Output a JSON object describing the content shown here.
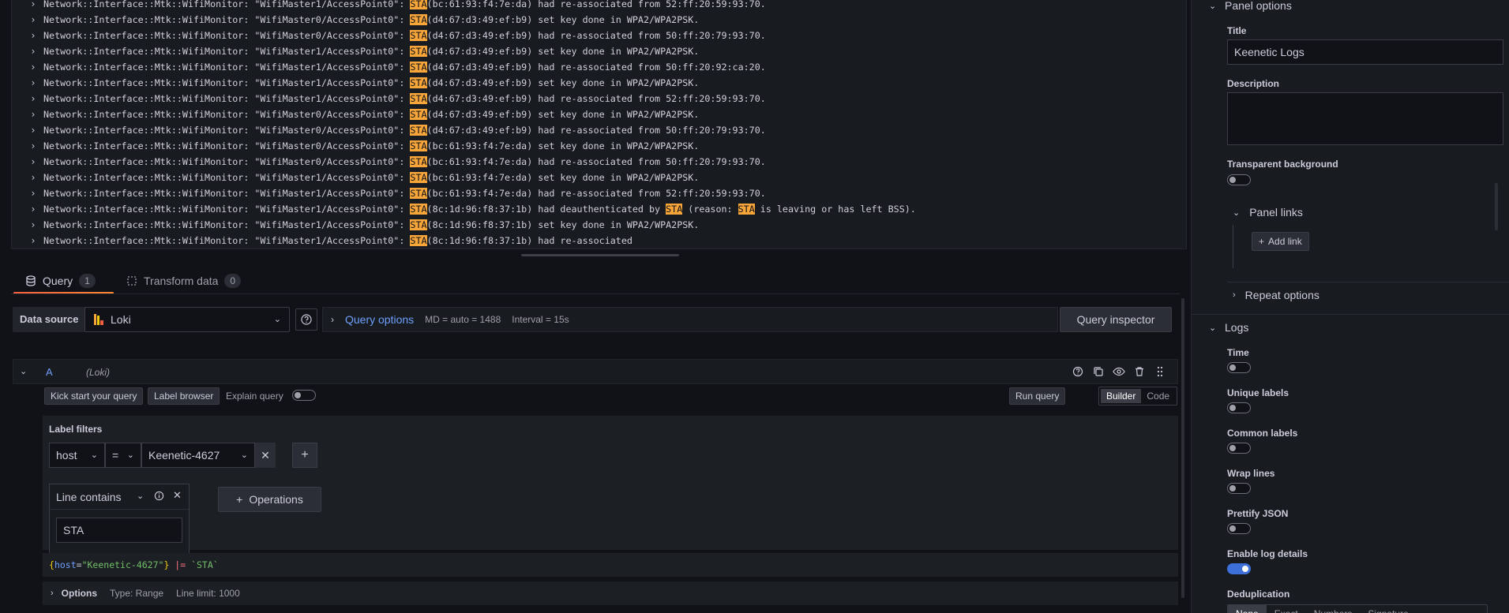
{
  "logs": {
    "lines": [
      {
        "pre": "Network::Interface::Mtk::WifiMonitor: \"WifiMaster1/AccessPoint0\": ",
        "hl": "STA",
        "post": "(bc:61:93:f4:7e:da) had re-associated from 52:ff:20:59:93:70."
      },
      {
        "pre": "Network::Interface::Mtk::WifiMonitor: \"WifiMaster0/AccessPoint0\": ",
        "hl": "STA",
        "post": "(d4:67:d3:49:ef:b9) set key done in WPA2/WPA2PSK."
      },
      {
        "pre": "Network::Interface::Mtk::WifiMonitor: \"WifiMaster0/AccessPoint0\": ",
        "hl": "STA",
        "post": "(d4:67:d3:49:ef:b9) had re-associated from 50:ff:20:79:93:70."
      },
      {
        "pre": "Network::Interface::Mtk::WifiMonitor: \"WifiMaster1/AccessPoint0\": ",
        "hl": "STA",
        "post": "(d4:67:d3:49:ef:b9) set key done in WPA2/WPA2PSK."
      },
      {
        "pre": "Network::Interface::Mtk::WifiMonitor: \"WifiMaster1/AccessPoint0\": ",
        "hl": "STA",
        "post": "(d4:67:d3:49:ef:b9) had re-associated from 50:ff:20:92:ca:20."
      },
      {
        "pre": "Network::Interface::Mtk::WifiMonitor: \"WifiMaster1/AccessPoint0\": ",
        "hl": "STA",
        "post": "(d4:67:d3:49:ef:b9) set key done in WPA2/WPA2PSK."
      },
      {
        "pre": "Network::Interface::Mtk::WifiMonitor: \"WifiMaster1/AccessPoint0\": ",
        "hl": "STA",
        "post": "(d4:67:d3:49:ef:b9) had re-associated from 52:ff:20:59:93:70."
      },
      {
        "pre": "Network::Interface::Mtk::WifiMonitor: \"WifiMaster0/AccessPoint0\": ",
        "hl": "STA",
        "post": "(d4:67:d3:49:ef:b9) set key done in WPA2/WPA2PSK."
      },
      {
        "pre": "Network::Interface::Mtk::WifiMonitor: \"WifiMaster0/AccessPoint0\": ",
        "hl": "STA",
        "post": "(d4:67:d3:49:ef:b9) had re-associated from 50:ff:20:79:93:70."
      },
      {
        "pre": "Network::Interface::Mtk::WifiMonitor: \"WifiMaster0/AccessPoint0\": ",
        "hl": "STA",
        "post": "(bc:61:93:f4:7e:da) set key done in WPA2/WPA2PSK."
      },
      {
        "pre": "Network::Interface::Mtk::WifiMonitor: \"WifiMaster0/AccessPoint0\": ",
        "hl": "STA",
        "post": "(bc:61:93:f4:7e:da) had re-associated from 50:ff:20:79:93:70."
      },
      {
        "pre": "Network::Interface::Mtk::WifiMonitor: \"WifiMaster1/AccessPoint0\": ",
        "hl": "STA",
        "post": "(bc:61:93:f4:7e:da) set key done in WPA2/WPA2PSK."
      },
      {
        "pre": "Network::Interface::Mtk::WifiMonitor: \"WifiMaster1/AccessPoint0\": ",
        "hl": "STA",
        "post": "(bc:61:93:f4:7e:da) had re-associated from 52:ff:20:59:93:70."
      },
      {
        "pre": "Network::Interface::Mtk::WifiMonitor: \"WifiMaster1/AccessPoint0\": ",
        "hl": "STA",
        "post": "(8c:1d:96:f8:37:1b) had deauthenticated by ",
        "hl2": "STA",
        "post2": " (reason: ",
        "hl3": "STA",
        "post3": " is leaving or has left BSS)."
      },
      {
        "pre": "Network::Interface::Mtk::WifiMonitor: \"WifiMaster1/AccessPoint0\": ",
        "hl": "STA",
        "post": "(8c:1d:96:f8:37:1b) set key done in WPA2/WPA2PSK."
      },
      {
        "pre": "Network::Interface::Mtk::WifiMonitor: \"WifiMaster1/AccessPoint0\": ",
        "hl": "STA",
        "post": "(8c:1d:96:f8:37:1b) had re-associated"
      }
    ]
  },
  "tabs": {
    "query": {
      "label": "Query",
      "count": "1"
    },
    "transform": {
      "label": "Transform data",
      "count": "0"
    }
  },
  "datasource": {
    "label": "Data source",
    "name": "Loki",
    "query_options_label": "Query options",
    "md": "MD = auto = 1488",
    "interval": "Interval = 15s",
    "inspector_label": "Query inspector"
  },
  "query_row": {
    "ref_id": "A",
    "ds_name": "(Loki)"
  },
  "builder": {
    "kick_start": "Kick start your query",
    "label_browser": "Label browser",
    "explain_query": "Explain query",
    "run_query": "Run query",
    "mode_builder": "Builder",
    "mode_code": "Code",
    "label_filters_title": "Label filters",
    "filter_label": "host",
    "filter_op": "=",
    "filter_value": "Keenetic-4627",
    "operation_name": "Line contains",
    "operation_value": "STA",
    "operations_button": "Operations",
    "preview": {
      "open_brace": "{",
      "key": "host",
      "eq": "=",
      "value": "\"Keenetic-4627\"",
      "close_brace": "}",
      "pipe": " |= ",
      "str": "`STA`"
    },
    "options_label": "Options",
    "options_type": "Type: Range",
    "options_limit": "Line limit: 1000"
  },
  "panel": {
    "panel_options": "Panel options",
    "title_label": "Title",
    "title_value": "Keenetic Logs",
    "description_label": "Description",
    "transparent_label": "Transparent background",
    "panel_links": "Panel links",
    "add_link": "Add link",
    "repeat_options": "Repeat options",
    "logs_section": "Logs",
    "time_label": "Time",
    "unique_labels": "Unique labels",
    "common_labels": "Common labels",
    "wrap_lines": "Wrap lines",
    "prettify_json": "Prettify JSON",
    "enable_log_details": "Enable log details",
    "deduplication": "Deduplication",
    "dedupe_options": [
      "None",
      "Exact",
      "Numbers",
      "Signature"
    ]
  },
  "colors": {
    "highlight": "#f8a539",
    "accent_blue": "#6e9fff",
    "tab_underline": "#f55f3e",
    "toggle_on": "#3d71d9"
  }
}
